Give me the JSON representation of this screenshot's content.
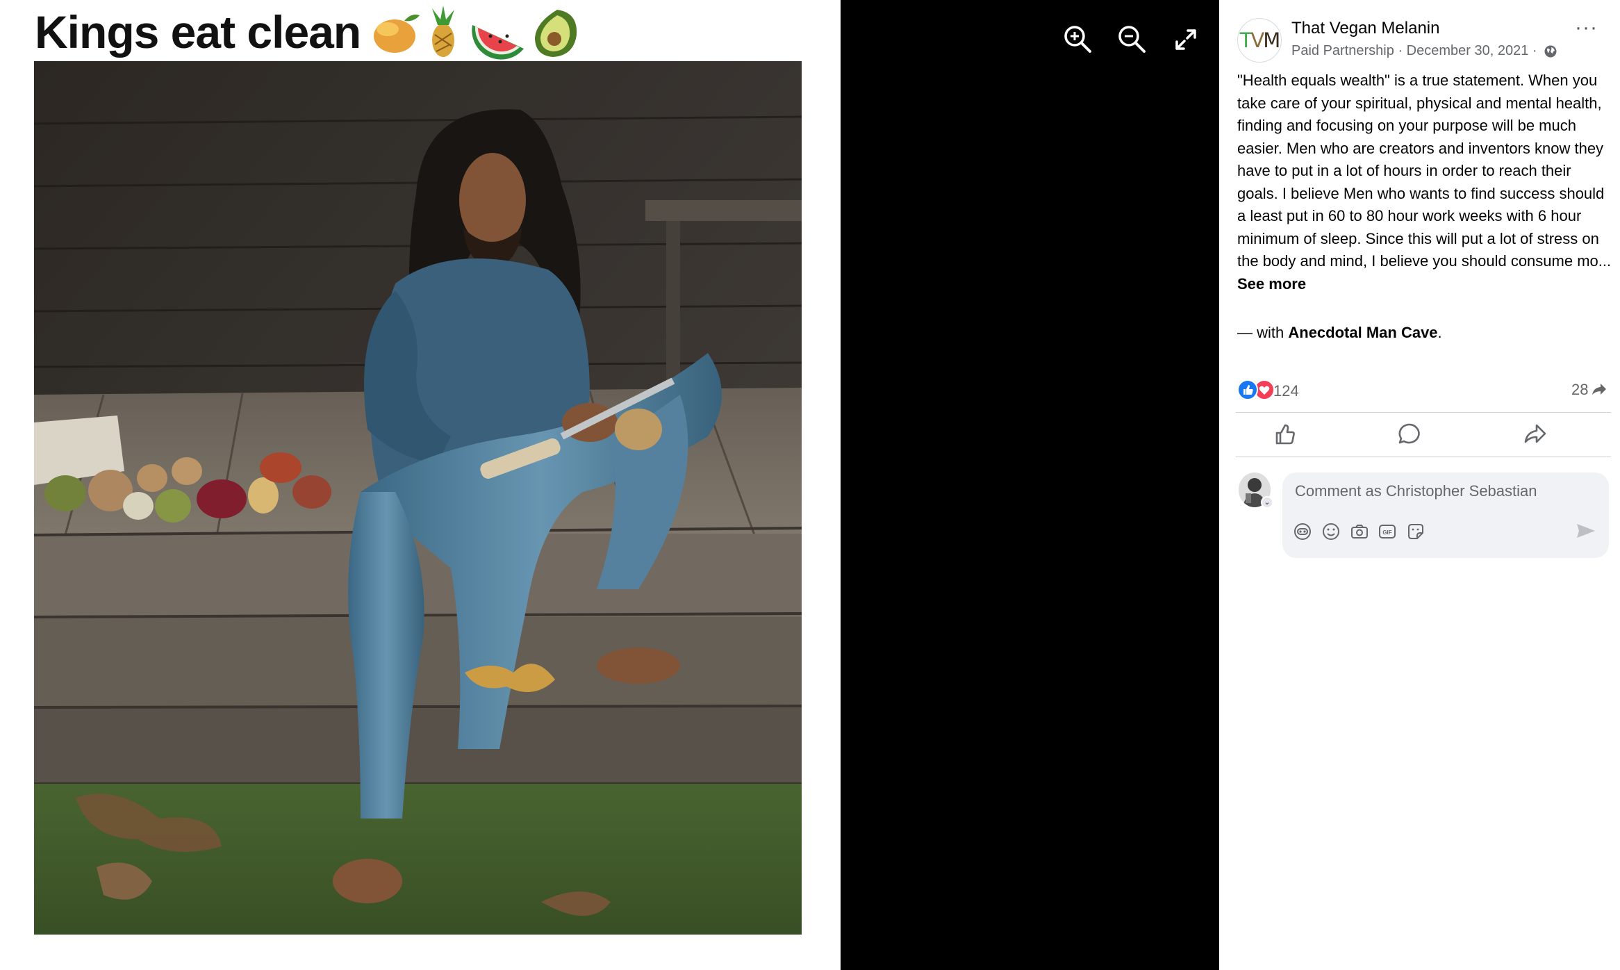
{
  "meme": {
    "title": "Kings eat clean",
    "emoji": [
      "mango-icon",
      "pineapple-icon",
      "watermelon-icon",
      "avocado-icon"
    ],
    "photo_desc_icon": "man-peeling-fruit-photo"
  },
  "viewer": {
    "zoom_in_icon": "zoom-in-icon",
    "zoom_out_icon": "zoom-out-icon",
    "fullscreen_icon": "fullscreen-icon"
  },
  "post": {
    "avatar_text": {
      "t": "T",
      "v": "V",
      "m": "M"
    },
    "page_name": "That Vegan Melanin",
    "partnership": "Paid Partnership",
    "date": "December 30, 2021",
    "separator": "·",
    "privacy_icon": "globe-icon",
    "more_label": "···",
    "caption": "\"Health equals wealth\" is a true statement. When you take care of your spiritual, physical and mental health, finding and focusing on your purpose will be much easier. Men who are creators and inventors know they have to put in a lot of hours in order to reach their goals. I believe Men who wants to find success should a least put in 60 to 80 hour work weeks with 6 hour minimum of sleep. Since this will put a lot of stress on the body and mind, I believe you should consume mo...",
    "see_more": "See more",
    "with_prefix": "— with",
    "tagged": "Anecdotal Man Cave",
    "tagged_suffix": ".",
    "reaction_icons": [
      "like-reaction-icon",
      "love-reaction-icon"
    ],
    "reaction_count": "124",
    "share_count": "28",
    "actions": [
      "like-icon",
      "comment-icon",
      "share-icon"
    ],
    "comment_placeholder": "Comment as Christopher Sebastian",
    "comment_tools": [
      "avatar-sticker-icon",
      "emoji-icon",
      "camera-icon",
      "gif-icon",
      "sticker-icon"
    ],
    "send_icon": "send-icon"
  },
  "colors": {
    "viewer_bg": "#000000",
    "like_blue": "#1877f2",
    "love_red": "#f33e58",
    "secondary_text": "#65676b",
    "input_bg": "#f0f2f5"
  }
}
